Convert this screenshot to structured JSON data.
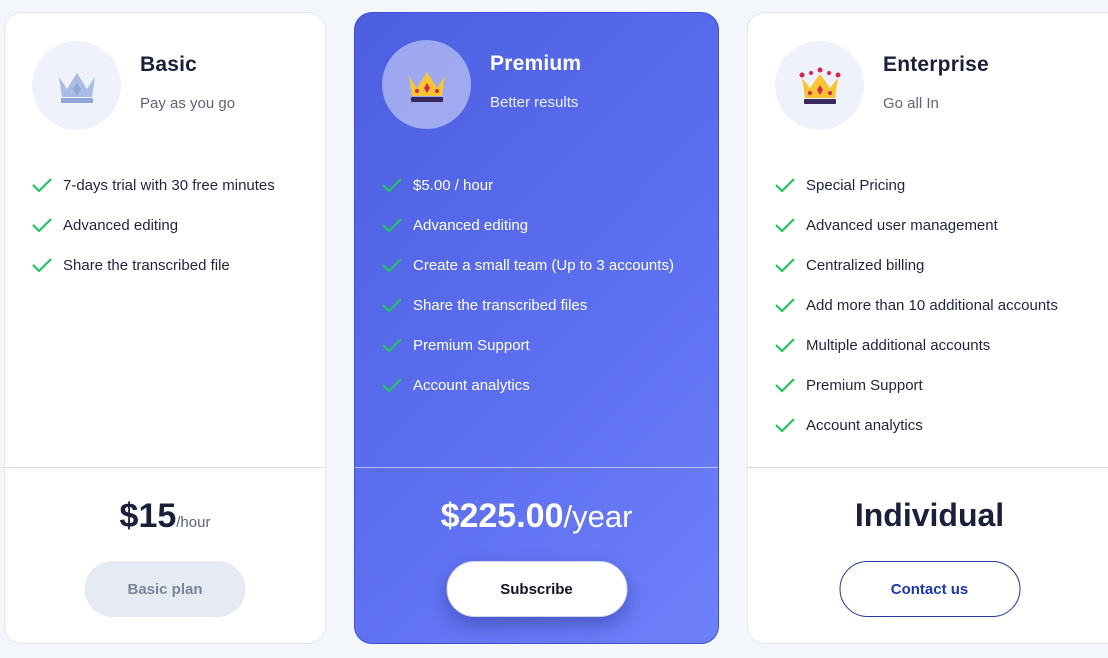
{
  "plans": [
    {
      "name": "Basic",
      "subtitle": "Pay as you go",
      "icon": "crown-icon",
      "features": [
        "7-days trial with 30 free minutes",
        "Advanced editing",
        "Share the transcribed file"
      ],
      "price": "$15",
      "price_unit": "/hour",
      "button_label": "Basic plan"
    },
    {
      "name": "Premium",
      "subtitle": "Better results",
      "icon": "crown-icon",
      "features": [
        "$5.00 / hour",
        "Advanced editing",
        "Create a small team (Up to 3 accounts)",
        "Share the transcribed files",
        "Premium Support",
        "Account analytics"
      ],
      "price": "$225.00",
      "price_unit": "/year",
      "button_label": "Subscribe"
    },
    {
      "name": "Enterprise",
      "subtitle": "Go all In",
      "icon": "crown-icon",
      "features": [
        "Special Pricing",
        "Advanced user management",
        "Centralized billing",
        "Add more than 10 additional accounts",
        "Multiple additional accounts",
        "Premium Support",
        "Account analytics"
      ],
      "price": "Individual",
      "price_unit": "",
      "button_label": "Contact us"
    }
  ],
  "colors": {
    "accent": "#4b5fe0",
    "check": "#22c55e",
    "contact": "#1a36b0"
  }
}
